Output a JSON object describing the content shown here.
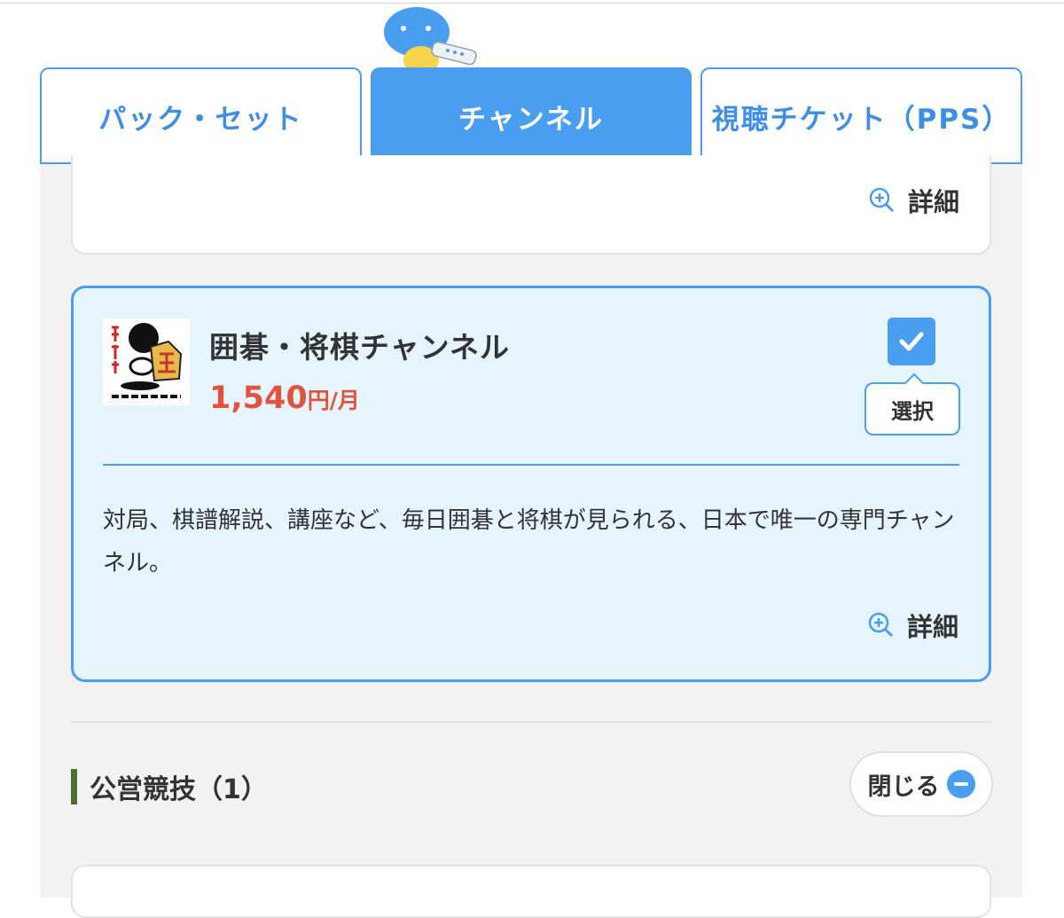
{
  "tabs": [
    {
      "label": "パック・セット",
      "active": false
    },
    {
      "label": "チャンネル",
      "active": true
    },
    {
      "label": "視聴チケット（PPS）",
      "active": false
    }
  ],
  "detail_label": "詳細",
  "channel": {
    "name": "囲碁・将棋チャンネル",
    "price": "1,540",
    "price_unit": "円/月",
    "select_label": "選択",
    "selected": true,
    "description": "対局、棋譜解説、講座など、毎日囲碁と将棋が見られる、日本で唯一の専門チャンネル。",
    "logo_text": "囲碁・将棋チャンネル"
  },
  "section": {
    "title": "公営競技（1）",
    "close_label": "閉じる"
  },
  "colors": {
    "accent": "#4a9ef0",
    "price": "#e0533c",
    "selected_bg": "#e6f4fd",
    "section_bar": "#4f6f2a"
  }
}
